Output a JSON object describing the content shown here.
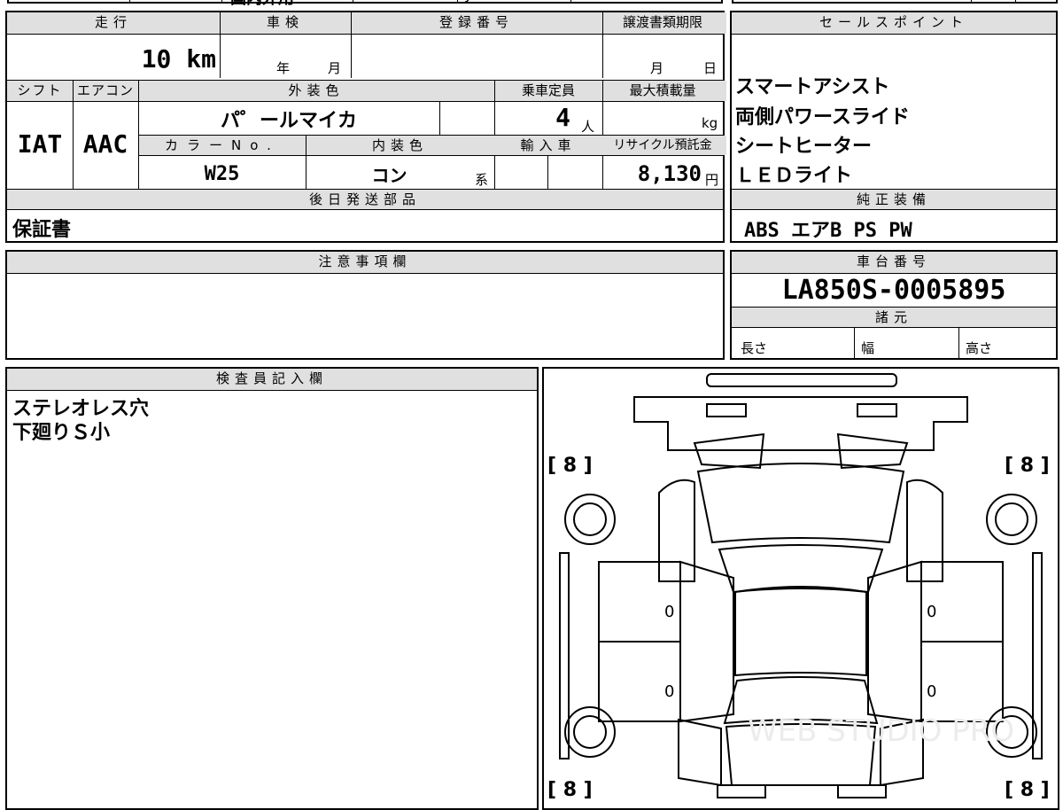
{
  "top_strip": {
    "partial_text": "国内外用",
    "partial_mark": "J"
  },
  "main_table": {
    "h_mileage": "走行",
    "h_inspection": "車検",
    "h_registration": "登録番号",
    "h_transfer_deadline": "譲渡書類期限",
    "mileage": "10 km",
    "inspection_year_label": "年",
    "inspection_month_label": "月",
    "transfer_month_label": "月",
    "transfer_day_label": "日",
    "h_shift": "シフト",
    "h_aircon": "エアコン",
    "h_exterior_color": "外装色",
    "h_capacity": "乗車定員",
    "h_max_load": "最大積載量",
    "shift": "IAT",
    "aircon": "AAC",
    "exterior_color": "パ゜ールマイカ",
    "capacity": "4",
    "capacity_unit": "人",
    "max_load_unit": "kg",
    "h_color_no": "カラーNo.",
    "h_interior_color": "内装色",
    "h_imported": "輸入車",
    "h_recycle": "リサイクル預託金",
    "color_no": "W25",
    "interior_color": "コン",
    "interior_suffix": "系",
    "recycle_fee": "8,130",
    "recycle_unit": "円",
    "h_later_parts": "後日発送部品",
    "later_parts": "保証書"
  },
  "sales_points": {
    "header": "セールスポイント",
    "items": [
      "スマートアシスト",
      "両側パワースライド",
      "シートヒーター",
      "ＬＥＤライト"
    ]
  },
  "genuine_equipment": {
    "header": "純正装備",
    "value": "ABS エアB PS PW"
  },
  "caution": {
    "header": "注意事項欄"
  },
  "chassis": {
    "header": "車台番号",
    "value": "LA850S-0005895",
    "spec_header": "諸元",
    "length_label": "長さ",
    "width_label": "幅",
    "height_label": "高さ"
  },
  "inspector": {
    "header": "検査員記入欄",
    "lines": [
      "ステレオレス穴",
      "下廻りＳ小"
    ]
  },
  "diagram": {
    "tire_fl": "[ 8 ]",
    "tire_fr": "[ 8 ]",
    "tire_rl": "[ 8 ]",
    "tire_rr": "[ 8 ]",
    "door_fl": "0",
    "door_fr": "0",
    "door_rl": "0",
    "door_rr": "0",
    "watermark": "WEB STUDIO PRO"
  }
}
